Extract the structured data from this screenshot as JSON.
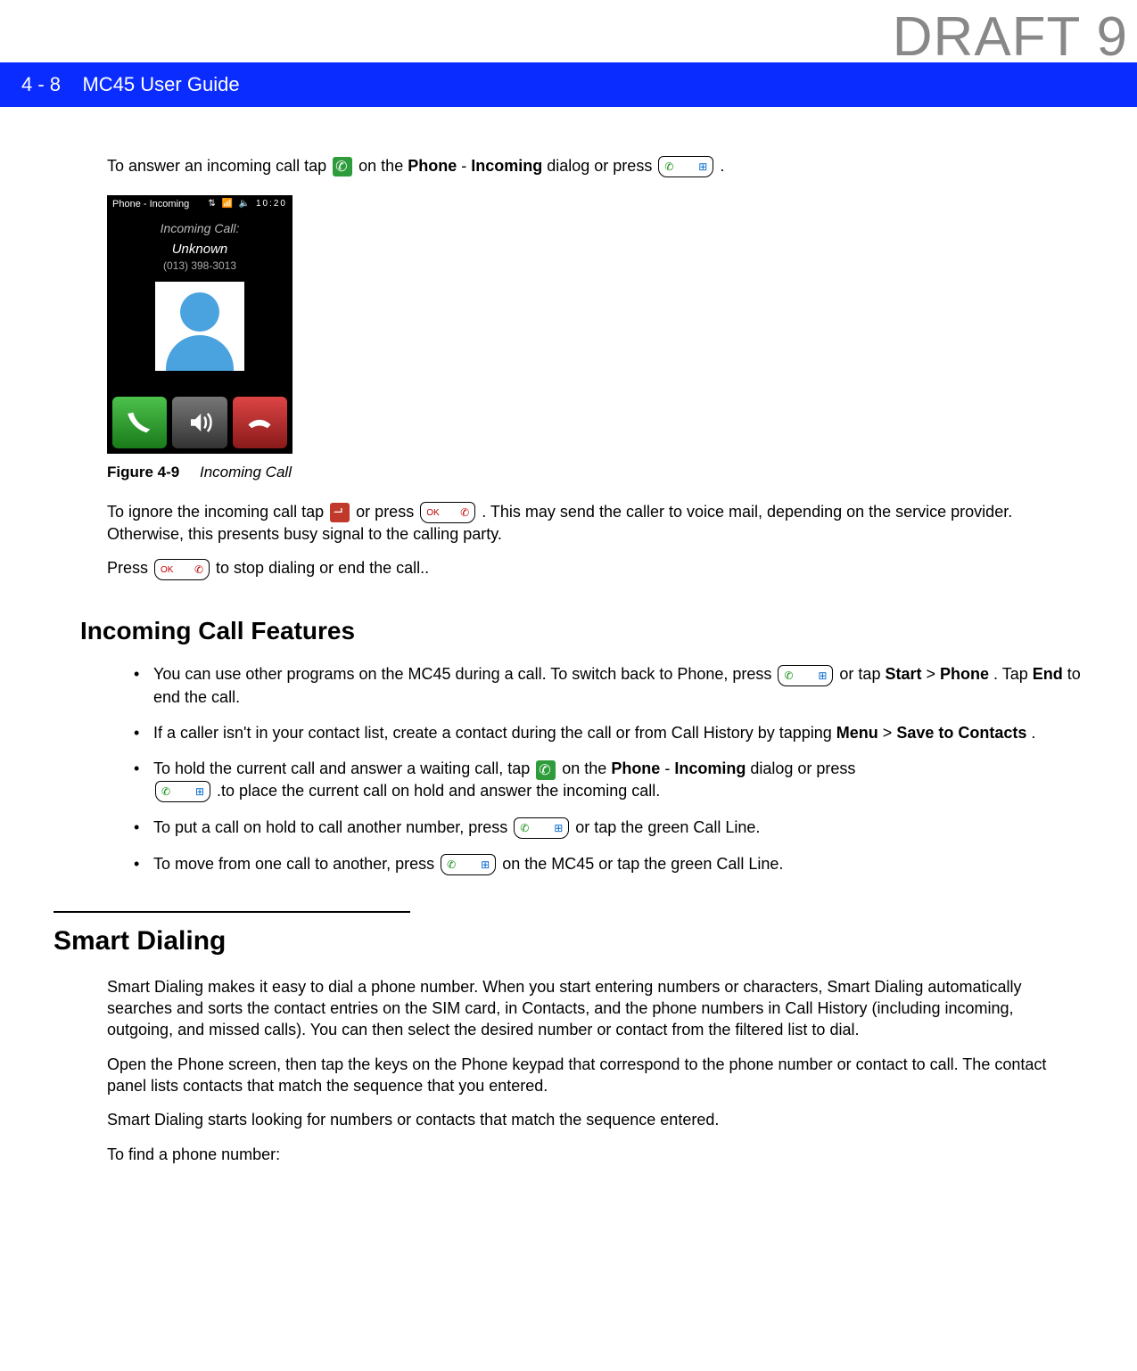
{
  "watermark": "DRAFT 9",
  "header": {
    "page_section": "4 - 8",
    "title": "MC45 User Guide"
  },
  "body": {
    "p1_a": "To answer an incoming call tap ",
    "p1_b": " on the ",
    "p1_c": "Phone",
    "p1_d": " - ",
    "p1_e": "Incoming",
    "p1_f": " dialog or press ",
    "p1_g": ".",
    "figure": {
      "label": "Figure 4-9",
      "title": "Incoming Call",
      "screenshot": {
        "titlebar_left": "Phone - Incoming",
        "titlebar_time": "10:20",
        "incoming_label": "Incoming Call:",
        "caller_name": "Unknown",
        "caller_number": "(013) 398-3013"
      }
    },
    "p2_a": "To ignore the incoming call tap ",
    "p2_b": " or press ",
    "p2_c": ". This may send the caller to voice mail, depending on the service provider. Otherwise, this presents busy signal to the calling party.",
    "p3_a": "Press ",
    "p3_b": " to stop dialing or end the call..",
    "h2": "Incoming Call Features",
    "bullets": {
      "0": {
        "a": "You can use other programs on the MC45 during a call. To switch back to Phone, press ",
        "b": " or tap ",
        "start": "Start",
        "c": " > ",
        "phone": "Phone",
        "d": ". Tap ",
        "end": "End",
        "e": " to end the call."
      },
      "1": {
        "a": "If a caller isn't in your contact list, create a contact during the call or from Call History by tapping ",
        "menu": "Menu",
        "b": " > ",
        "save": "Save to Contacts",
        "c": "."
      },
      "2": {
        "a": "To hold the current call and answer a waiting call, tap ",
        "b": " on the ",
        "phone": "Phone",
        "c": " - ",
        "incoming": "Incoming",
        "d": " dialog or press ",
        "e": ".to place the current call on hold and answer the incoming call."
      },
      "3": {
        "a": "To put a call on hold to call another number, press ",
        "b": " or tap the green Call Line."
      },
      "4": {
        "a": "To move from one call to another, press ",
        "b": " on the MC45 or tap the green Call Line."
      }
    },
    "h1": "Smart Dialing",
    "sd_p1": "Smart Dialing makes it easy to dial a phone number. When you start entering numbers or characters, Smart Dialing automatically searches and sorts the contact entries on the SIM card, in Contacts, and the phone numbers in Call History (including incoming, outgoing, and missed calls). You can then select the desired number or contact from the filtered list to dial.",
    "sd_p2": "Open the Phone screen, then tap the keys on the Phone keypad that correspond to the phone number or contact to call. The contact panel lists contacts that match the sequence that you entered.",
    "sd_p3": "Smart Dialing starts looking for numbers or contacts that match the sequence entered.",
    "sd_p4": "To find a phone number:"
  }
}
